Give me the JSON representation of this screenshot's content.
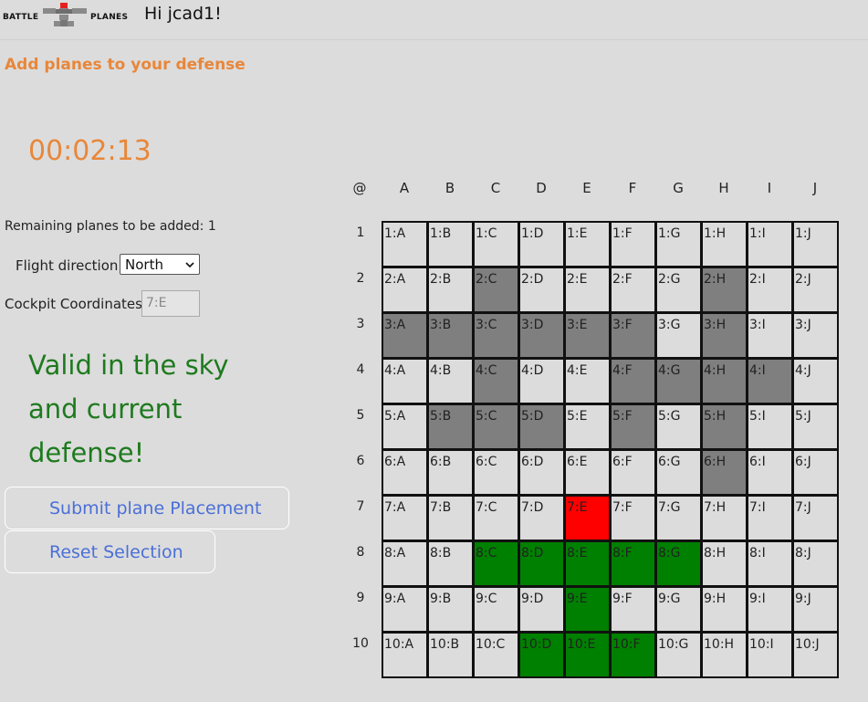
{
  "header": {
    "logo_left": "BATTLE",
    "logo_right": "PLANES",
    "greeting": "Hi jcad1!"
  },
  "subtitle": "Add planes to your defense",
  "timer": "00:02:13",
  "remaining": "Remaining planes to be added: 1",
  "flight_direction": {
    "label": "Flight direction:",
    "value": "North"
  },
  "cockpit": {
    "label": "Cockpit Coordinates:",
    "value": "7:E"
  },
  "status_message": "Valid in the sky and current defense!",
  "buttons": {
    "submit": "Submit plane Placement",
    "reset": "Reset Selection"
  },
  "colors": {
    "placed": "#7f7f7f",
    "selected": "#008000",
    "cockpit": "#ff0000",
    "accent": "#e8873a",
    "valid": "#1e7a1e"
  },
  "grid": {
    "corner": "@",
    "columns": [
      "A",
      "B",
      "C",
      "D",
      "E",
      "F",
      "G",
      "H",
      "I",
      "J"
    ],
    "rows": [
      "1",
      "2",
      "3",
      "4",
      "5",
      "6",
      "7",
      "8",
      "9",
      "10"
    ],
    "placed_cells": [
      "2:C",
      "2:H",
      "3:A",
      "3:B",
      "3:C",
      "3:D",
      "3:E",
      "3:F",
      "3:H",
      "4:C",
      "4:F",
      "4:G",
      "4:H",
      "4:I",
      "5:B",
      "5:C",
      "5:D",
      "5:F",
      "5:H",
      "6:H"
    ],
    "selected_cells": [
      "8:C",
      "8:D",
      "8:E",
      "8:F",
      "8:G",
      "9:E",
      "10:D",
      "10:E",
      "10:F"
    ],
    "cockpit_cell": "7:E"
  }
}
